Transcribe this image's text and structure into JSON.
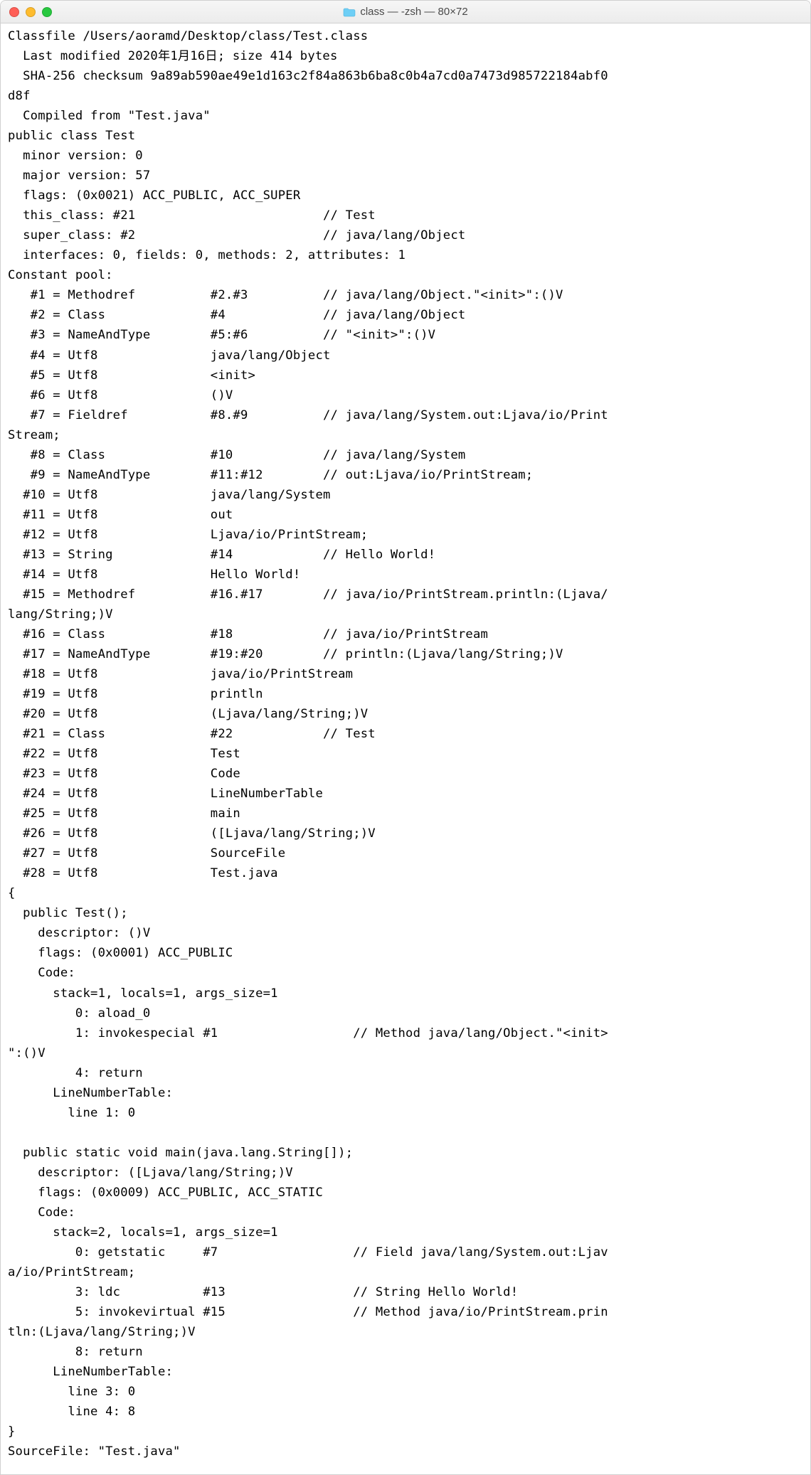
{
  "window": {
    "title": "class — -zsh — 80×72"
  },
  "terminal": {
    "lines": [
      "Classfile /Users/aoramd/Desktop/class/Test.class",
      "  Last modified 2020年1月16日; size 414 bytes",
      "  SHA-256 checksum 9a89ab590ae49e1d163c2f84a863b6ba8c0b4a7cd0a7473d985722184abf0",
      "d8f",
      "  Compiled from \"Test.java\"",
      "public class Test",
      "  minor version: 0",
      "  major version: 57",
      "  flags: (0x0021) ACC_PUBLIC, ACC_SUPER",
      "  this_class: #21                         // Test",
      "  super_class: #2                         // java/lang/Object",
      "  interfaces: 0, fields: 0, methods: 2, attributes: 1",
      "Constant pool:",
      "   #1 = Methodref          #2.#3          // java/lang/Object.\"<init>\":()V",
      "   #2 = Class              #4             // java/lang/Object",
      "   #3 = NameAndType        #5:#6          // \"<init>\":()V",
      "   #4 = Utf8               java/lang/Object",
      "   #5 = Utf8               <init>",
      "   #6 = Utf8               ()V",
      "   #7 = Fieldref           #8.#9          // java/lang/System.out:Ljava/io/Print",
      "Stream;",
      "   #8 = Class              #10            // java/lang/System",
      "   #9 = NameAndType        #11:#12        // out:Ljava/io/PrintStream;",
      "  #10 = Utf8               java/lang/System",
      "  #11 = Utf8               out",
      "  #12 = Utf8               Ljava/io/PrintStream;",
      "  #13 = String             #14            // Hello World!",
      "  #14 = Utf8               Hello World!",
      "  #15 = Methodref          #16.#17        // java/io/PrintStream.println:(Ljava/",
      "lang/String;)V",
      "  #16 = Class              #18            // java/io/PrintStream",
      "  #17 = NameAndType        #19:#20        // println:(Ljava/lang/String;)V",
      "  #18 = Utf8               java/io/PrintStream",
      "  #19 = Utf8               println",
      "  #20 = Utf8               (Ljava/lang/String;)V",
      "  #21 = Class              #22            // Test",
      "  #22 = Utf8               Test",
      "  #23 = Utf8               Code",
      "  #24 = Utf8               LineNumberTable",
      "  #25 = Utf8               main",
      "  #26 = Utf8               ([Ljava/lang/String;)V",
      "  #27 = Utf8               SourceFile",
      "  #28 = Utf8               Test.java",
      "{",
      "  public Test();",
      "    descriptor: ()V",
      "    flags: (0x0001) ACC_PUBLIC",
      "    Code:",
      "      stack=1, locals=1, args_size=1",
      "         0: aload_0",
      "         1: invokespecial #1                  // Method java/lang/Object.\"<init>",
      "\":()V",
      "         4: return",
      "      LineNumberTable:",
      "        line 1: 0",
      "",
      "  public static void main(java.lang.String[]);",
      "    descriptor: ([Ljava/lang/String;)V",
      "    flags: (0x0009) ACC_PUBLIC, ACC_STATIC",
      "    Code:",
      "      stack=2, locals=1, args_size=1",
      "         0: getstatic     #7                  // Field java/lang/System.out:Ljav",
      "a/io/PrintStream;",
      "         3: ldc           #13                 // String Hello World!",
      "         5: invokevirtual #15                 // Method java/io/PrintStream.prin",
      "tln:(Ljava/lang/String;)V",
      "         8: return",
      "      LineNumberTable:",
      "        line 3: 0",
      "        line 4: 8",
      "}",
      "SourceFile: \"Test.java\""
    ]
  }
}
